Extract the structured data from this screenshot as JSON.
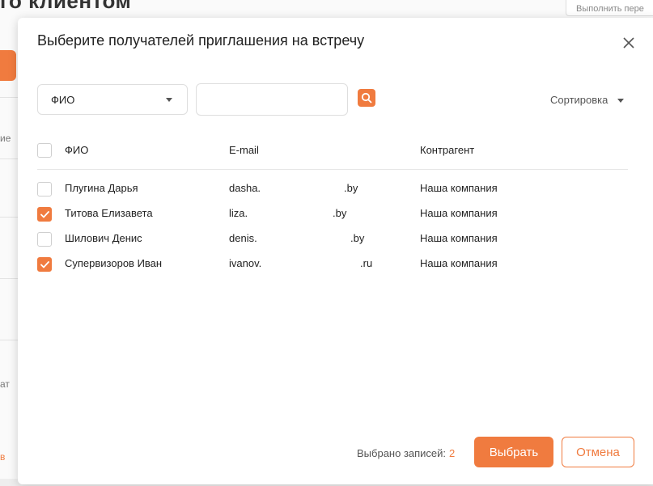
{
  "background": {
    "page_title_fragment": "го клиентом",
    "top_right_button": "Выполнить пере",
    "left_fragments": [
      "ие",
      "ат",
      "в"
    ]
  },
  "modal": {
    "title": "Выберите получателей приглашения на встречу",
    "close_icon": "close-icon"
  },
  "filters": {
    "field_select": {
      "value": "ФИО"
    },
    "search": {
      "value": "",
      "placeholder": ""
    },
    "search_icon": "search-icon",
    "sort_label": "Сортировка"
  },
  "table": {
    "headers": {
      "name": "ФИО",
      "email": "E-mail",
      "company": "Контрагент"
    },
    "rows": [
      {
        "checked": false,
        "name": "Плугина Дарья",
        "email_start": "dasha.",
        "email_end": ".by",
        "company": "Наша компания"
      },
      {
        "checked": true,
        "name": "Титова Елизавета",
        "email_start": "liza.",
        "email_end": ".by",
        "company": "Наша компания"
      },
      {
        "checked": false,
        "name": "Шилович Денис",
        "email_start": "denis.",
        "email_end": ".by",
        "company": "Наша компания"
      },
      {
        "checked": true,
        "name": "Супервизоров Иван",
        "email_start": "ivanov.",
        "email_end": ".ru",
        "company": "Наша компания"
      }
    ]
  },
  "footer": {
    "selected_label": "Выбрано записей:",
    "selected_count": "2",
    "select_button": "Выбрать",
    "cancel_button": "Отмена"
  },
  "colors": {
    "accent": "#f07b3f",
    "border": "#dedede",
    "text": "#222222"
  }
}
